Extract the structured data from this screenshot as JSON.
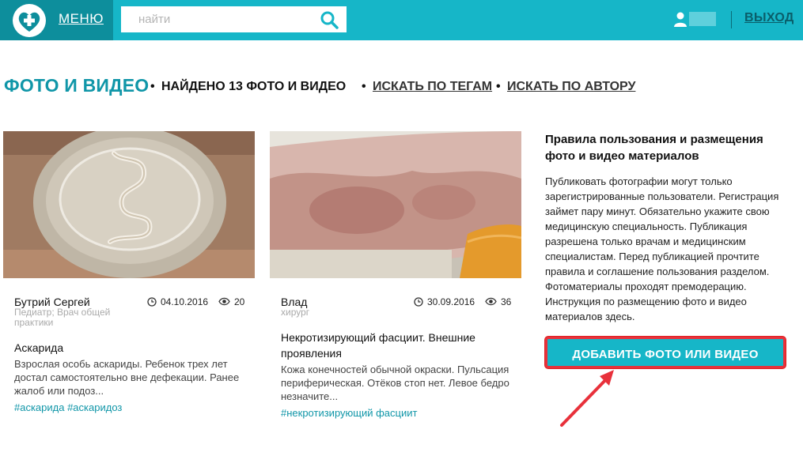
{
  "header": {
    "menu_label": "МЕНЮ",
    "search_placeholder": "найти",
    "logout_label": "ВЫХОД"
  },
  "title_row": {
    "page_title": "ФОТО И ВИДЕО",
    "found_text": "НАЙДЕНО 13 ФОТО И ВИДЕО",
    "search_by_tags": "ИСКАТЬ ПО ТЕГАМ",
    "search_by_author": "ИСКАТЬ ПО АВТОРУ",
    "separator": "•"
  },
  "cards": [
    {
      "author": "Бутрий Сергей",
      "role": "Педиатр; Врач общей практики",
      "date": "04.10.2016",
      "views": "20",
      "title": "Аскарида",
      "description": "Взрослая особь аскариды. Ребенок трех лет достал самостоятельно вне дефекации. Ранее жалоб или подоз...",
      "tags": "#аскарида #аскаридоз"
    },
    {
      "author": "Влад",
      "role": "хирург",
      "date": "30.09.2016",
      "views": "36",
      "title": "Некротизирующий фасциит. Внешние проявления",
      "description": "Кожа конечностей обычной окраски. Пульсация периферическая. Отёков стоп нет. Левое бедро незначите...",
      "tags": "#некротизирующий фасциит"
    }
  ],
  "sidebar": {
    "title": "Правила пользования и размещения фото и видео материалов",
    "text": "Публиковать фотографии могут только зарегистрированные пользователи. Регистрация займет пару минут. Обязательно укажите свою медицинскую специальность. Публикация разрешена только врачам и медицинским специалистам. Перед публикацией прочтите правила и соглашение пользования разделом. Фотоматериалы проходят премодерацию. Инструкция по размещению фото и видео материалов здесь.",
    "add_button": "ДОБАВИТЬ ФОТО ИЛИ ВИДЕО"
  },
  "colors": {
    "header": "#16b6c8",
    "menu_block": "#0d8e9c",
    "accent": "#1096a8",
    "highlight": "#e8313b"
  }
}
